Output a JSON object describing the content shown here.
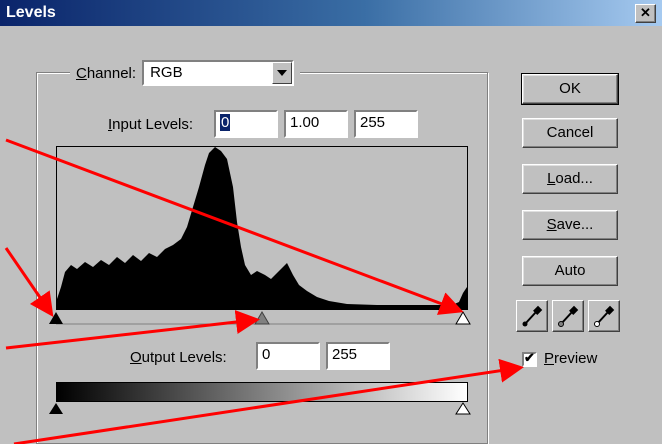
{
  "window": {
    "title": "Levels",
    "close_glyph": "✕"
  },
  "channel": {
    "label_hotkey": "C",
    "label_rest": "hannel:",
    "value": "RGB"
  },
  "input_levels": {
    "label_hotkey": "I",
    "label_rest": "nput Levels:",
    "black": "0",
    "gamma": "1.00",
    "white": "255"
  },
  "output_levels": {
    "label_hotkey": "O",
    "label_rest": "utput Levels:",
    "black": "0",
    "white": "255"
  },
  "buttons": {
    "ok": "OK",
    "cancel": "Cancel",
    "load_hotkey": "L",
    "load_rest": "oad...",
    "save_hotkey": "S",
    "save_rest": "ave...",
    "auto": "Auto"
  },
  "preview": {
    "hotkey": "P",
    "rest": "review",
    "checked": true,
    "check_glyph": "✔"
  },
  "icons": [
    "black-eyedropper-icon",
    "gray-eyedropper-icon",
    "white-eyedropper-icon"
  ],
  "colors": {
    "title_start": "#0a246a",
    "title_end": "#a6caf0",
    "annotation_arrow": "#ff0000",
    "face": "#c0c0c0"
  }
}
